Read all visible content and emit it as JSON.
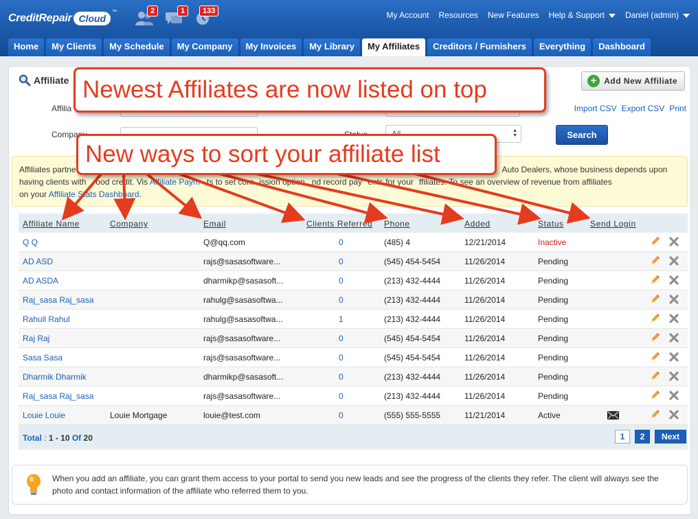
{
  "brand": {
    "logo_text": "CreditRepair",
    "logo_cloud": "Cloud",
    "logo_tm": "™"
  },
  "notifications": [
    {
      "icon": "users-icon",
      "count": "2"
    },
    {
      "icon": "chat-icon",
      "count": "1"
    },
    {
      "icon": "clock-icon",
      "count": "133"
    }
  ],
  "toplinks": {
    "account": "My Account",
    "resources": "Resources",
    "features": "New Features",
    "help": "Help & Support",
    "user": "Daniel (admin)"
  },
  "tabs": [
    {
      "label": "Home",
      "active": false
    },
    {
      "label": "My Clients",
      "active": false
    },
    {
      "label": "My Schedule",
      "active": false
    },
    {
      "label": "My Company",
      "active": false
    },
    {
      "label": "My Invoices",
      "active": false
    },
    {
      "label": "My Library",
      "active": false
    },
    {
      "label": "My Affiliates",
      "active": true
    },
    {
      "label": "Creditors / Furnishers",
      "active": false
    },
    {
      "label": "Everything",
      "active": false
    },
    {
      "label": "Dashboard",
      "active": false
    }
  ],
  "search": {
    "title": "Affiliate",
    "name_label": "Affilia",
    "company_label": "Company",
    "status_label": "Status",
    "status_value": "All",
    "search_button": "Search"
  },
  "actions": {
    "add_button": "Add New Affiliate",
    "import_csv": "Import CSV",
    "export_csv": "Export CSV",
    "print": "Print"
  },
  "info": {
    "line1_start": "Affiliates partne",
    "line1_end": "Auto Dealers, whose business depends upon",
    "line2_a": "having clients with",
    "line2_b": "ood credit. Vis",
    "line2_link": "Affiliate Paym",
    "line2_c": "ts to set com",
    "line2_d": "ission option",
    "line2_e": "nd record pay",
    "line2_f": "ents for your",
    "line2_g": "ffiliates. To see an overview of revenue from affiliates",
    "line3_a": "on your",
    "line3_link": "Affiliate Stats Dashboard",
    "line3_b": "."
  },
  "table": {
    "headers": {
      "name": "Affiliate Name",
      "company": "Company",
      "email": "Email",
      "referred": "Clients Referred",
      "phone": "Phone",
      "added": "Added",
      "status": "Status",
      "send_login": "Send Login"
    },
    "rows": [
      {
        "name": "Q Q",
        "company": "",
        "email": "Q@qq.com",
        "referred": "0",
        "phone": "(485) 4",
        "added": "12/21/2014",
        "status": "Inactive",
        "mail": false
      },
      {
        "name": "AD ASD",
        "company": "",
        "email": "rajs@sasasoftware...",
        "referred": "0",
        "phone": "(545) 454-5454",
        "added": "11/26/2014",
        "status": "Pending",
        "mail": false
      },
      {
        "name": "AD ASDA",
        "company": "",
        "email": "dharmikp@sasasoft...",
        "referred": "0",
        "phone": "(213) 432-4444",
        "added": "11/26/2014",
        "status": "Pending",
        "mail": false
      },
      {
        "name": "Raj_sasa Raj_sasa",
        "company": "",
        "email": "rahulg@sasasoftwa...",
        "referred": "0",
        "phone": "(213) 432-4444",
        "added": "11/26/2014",
        "status": "Pending",
        "mail": false
      },
      {
        "name": "Rahull Rahul",
        "company": "",
        "email": "rahulg@sasasoftwa...",
        "referred": "1",
        "phone": "(213) 432-4444",
        "added": "11/26/2014",
        "status": "Pending",
        "mail": false
      },
      {
        "name": "Raj Raj",
        "company": "",
        "email": "rajs@sasasoftware...",
        "referred": "0",
        "phone": "(545) 454-5454",
        "added": "11/26/2014",
        "status": "Pending",
        "mail": false
      },
      {
        "name": "Sasa Sasa",
        "company": "",
        "email": "rajs@sasasoftware...",
        "referred": "0",
        "phone": "(545) 454-5454",
        "added": "11/26/2014",
        "status": "Pending",
        "mail": false
      },
      {
        "name": "Dharmik Dharmik",
        "company": "",
        "email": "dharmikp@sasasoft...",
        "referred": "0",
        "phone": "(213) 432-4444",
        "added": "11/26/2014",
        "status": "Pending",
        "mail": false
      },
      {
        "name": "Raj_sasa Raj_sasa",
        "company": "",
        "email": "rajs@sasasoftware...",
        "referred": "0",
        "phone": "(213) 432-4444",
        "added": "11/26/2014",
        "status": "Pending",
        "mail": false
      },
      {
        "name": "Louie Louie",
        "company": "Louie Mortgage",
        "email": "louie@test.com",
        "referred": "0",
        "phone": "(555) 555-5555",
        "added": "11/21/2014",
        "status": "Active",
        "mail": true
      }
    ],
    "total_label": "Total",
    "total_sep": ":",
    "total_range": "1 - 10",
    "total_of": "Of",
    "total_count": "20",
    "pages": [
      "1",
      "2"
    ],
    "next": "Next"
  },
  "tip": {
    "text": "When you add an affiliate, you can grant them access to your portal to send you new leads and see the progress of the clients they refer. The client will always see the photo and contact information of the affiliate who referred them to you."
  },
  "callouts": {
    "top": "Newest Affiliates are now listed on top",
    "sort": "New ways to sort your affiliate list"
  },
  "colors": {
    "header_blue": "#1b58a8",
    "link_blue": "#1b5fb8",
    "badge_red": "#e32020",
    "annotation_red": "#e43c1e",
    "inactive_red": "#d42020",
    "info_bg": "#fdfbd6"
  }
}
